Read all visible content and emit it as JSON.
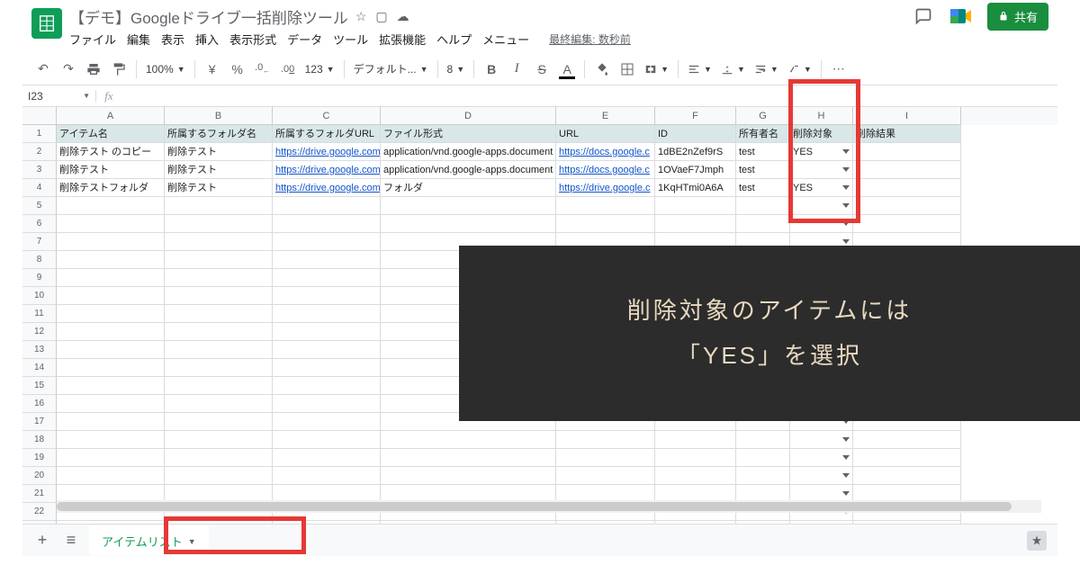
{
  "title": "【デモ】Googleドライブ一括削除ツール",
  "last_edit": "最終編集: 数秒前",
  "share_label": "共有",
  "menus": [
    "ファイル",
    "編集",
    "表示",
    "挿入",
    "表示形式",
    "データ",
    "ツール",
    "拡張機能",
    "ヘルプ",
    "メニュー"
  ],
  "toolbar": {
    "zoom": "100%",
    "currency": "¥",
    "percent": "%",
    "dec_less": ".0",
    "dec_more": ".00",
    "numfmt": "123",
    "font": "デフォルト...",
    "fontsize": "8"
  },
  "name_box": "I23",
  "columns": [
    "A",
    "B",
    "C",
    "D",
    "E",
    "F",
    "G",
    "H",
    "I"
  ],
  "headers": {
    "A": "アイテム名",
    "B": "所属するフォルダ名",
    "C": "所属するフォルダURL",
    "D": "ファイル形式",
    "E": "URL",
    "F": "ID",
    "G": "所有者名",
    "H": "削除対象",
    "I": "削除結果"
  },
  "rows": [
    {
      "A": "削除テスト のコピー",
      "B": "削除テスト",
      "C": "https://drive.google.com/d",
      "D": "application/vnd.google-apps.document",
      "E": "https://docs.google.c",
      "F": "1dBE2nZef9rS",
      "G": "test",
      "H": "YES",
      "I": ""
    },
    {
      "A": "削除テスト",
      "B": "削除テスト",
      "C": "https://drive.google.com/d",
      "D": "application/vnd.google-apps.document",
      "E": "https://docs.google.c",
      "F": "1OVaeF7Jmph",
      "G": "test",
      "H": "",
      "I": ""
    },
    {
      "A": "削除テストフォルダ",
      "B": "削除テスト",
      "C": "https://drive.google.com/d",
      "D": "フォルダ",
      "E": "https://drive.google.c",
      "F": "1KqHTmi0A6A",
      "G": "test",
      "H": "YES",
      "I": ""
    }
  ],
  "annotation": {
    "line1": "削除対象のアイテムには",
    "line2": "「YES」を選択"
  },
  "tab_name": "アイテムリスト"
}
